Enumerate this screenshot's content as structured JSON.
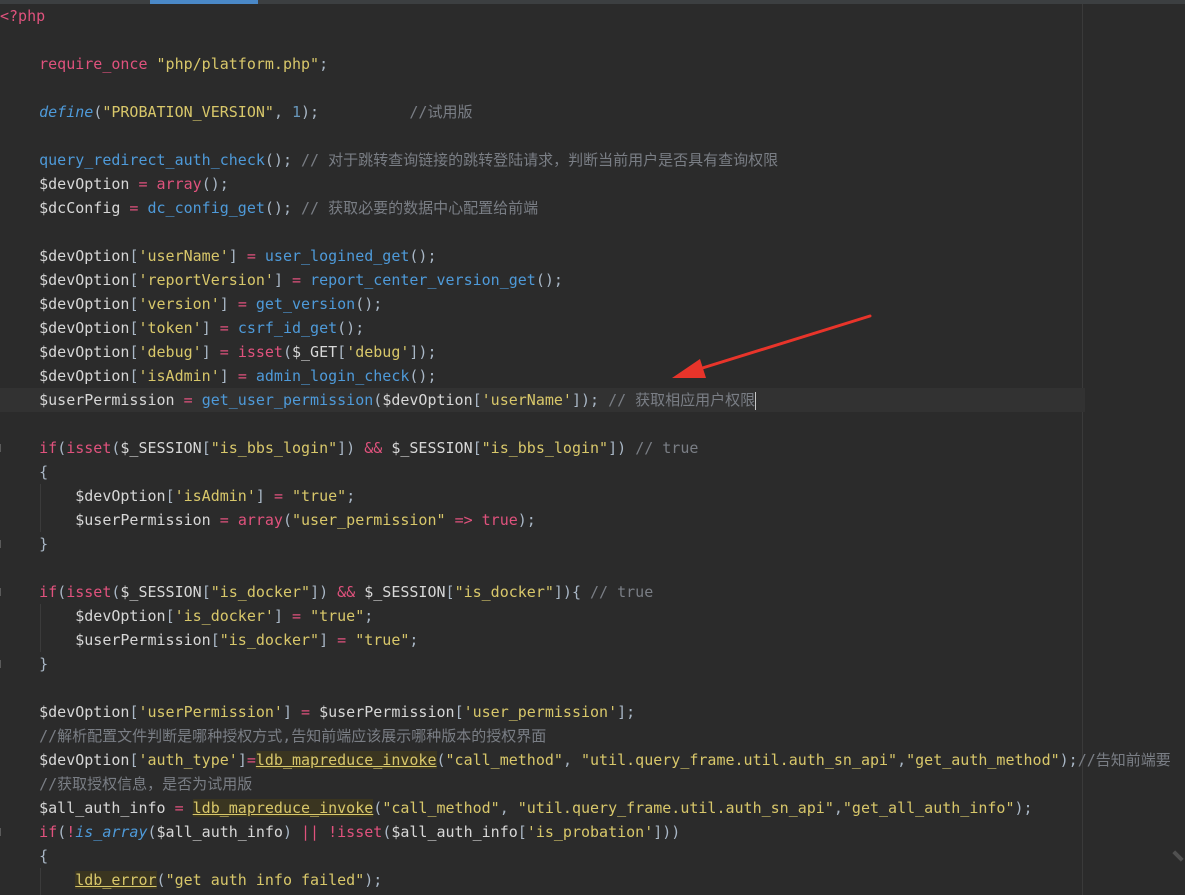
{
  "editor": {
    "lines": [
      {
        "id": "l1",
        "tokens": [
          {
            "t": "<?php",
            "c": "phptag"
          }
        ]
      },
      {
        "id": "l2",
        "tokens": []
      },
      {
        "id": "l3",
        "tokens": [
          {
            "t": "    "
          },
          {
            "t": "require_once",
            "c": "pink"
          },
          {
            "t": " "
          },
          {
            "t": "\"php/platform.php\"",
            "c": "str"
          },
          {
            "t": ";",
            "c": "punc"
          }
        ]
      },
      {
        "id": "l4",
        "tokens": []
      },
      {
        "id": "l5",
        "tokens": [
          {
            "t": "    "
          },
          {
            "t": "define",
            "c": "def"
          },
          {
            "t": "(",
            "c": "punc"
          },
          {
            "t": "\"PROBATION_VERSION\"",
            "c": "str"
          },
          {
            "t": ", ",
            "c": "punc"
          },
          {
            "t": "1",
            "c": "num"
          },
          {
            "t": ");",
            "c": "punc"
          },
          {
            "t": "          "
          },
          {
            "t": "//试用版",
            "c": "cmt"
          }
        ]
      },
      {
        "id": "l6",
        "tokens": []
      },
      {
        "id": "l7",
        "tokens": [
          {
            "t": "    "
          },
          {
            "t": "query_redirect_auth_check",
            "c": "fn"
          },
          {
            "t": "(); ",
            "c": "punc"
          },
          {
            "t": "// 对于跳转查询链接的跳转登陆请求，判断当前用户是否具有查询权限",
            "c": "cmt"
          }
        ]
      },
      {
        "id": "l8",
        "tokens": [
          {
            "t": "    "
          },
          {
            "t": "$devOption",
            "c": "var"
          },
          {
            "t": " = ",
            "c": "pink"
          },
          {
            "t": "array",
            "c": "pink"
          },
          {
            "t": "();",
            "c": "punc"
          }
        ]
      },
      {
        "id": "l9",
        "tokens": [
          {
            "t": "    "
          },
          {
            "t": "$dcConfig",
            "c": "var"
          },
          {
            "t": " = ",
            "c": "pink"
          },
          {
            "t": "dc_config_get",
            "c": "fn"
          },
          {
            "t": "(); ",
            "c": "punc"
          },
          {
            "t": "// 获取必要的数据中心配置给前端",
            "c": "cmt"
          }
        ]
      },
      {
        "id": "l10",
        "tokens": []
      },
      {
        "id": "l11",
        "tokens": [
          {
            "t": "    "
          },
          {
            "t": "$devOption",
            "c": "var"
          },
          {
            "t": "[",
            "c": "punc"
          },
          {
            "t": "'userName'",
            "c": "str"
          },
          {
            "t": "] ",
            "c": "punc"
          },
          {
            "t": "=",
            "c": "pink"
          },
          {
            "t": " "
          },
          {
            "t": "user_logined_get",
            "c": "fn"
          },
          {
            "t": "();",
            "c": "punc"
          }
        ]
      },
      {
        "id": "l12",
        "tokens": [
          {
            "t": "    "
          },
          {
            "t": "$devOption",
            "c": "var"
          },
          {
            "t": "[",
            "c": "punc"
          },
          {
            "t": "'reportVersion'",
            "c": "str"
          },
          {
            "t": "] ",
            "c": "punc"
          },
          {
            "t": "=",
            "c": "pink"
          },
          {
            "t": " "
          },
          {
            "t": "report_center_version_get",
            "c": "fn"
          },
          {
            "t": "();",
            "c": "punc"
          }
        ]
      },
      {
        "id": "l13",
        "tokens": [
          {
            "t": "    "
          },
          {
            "t": "$devOption",
            "c": "var"
          },
          {
            "t": "[",
            "c": "punc"
          },
          {
            "t": "'version'",
            "c": "str"
          },
          {
            "t": "] ",
            "c": "punc"
          },
          {
            "t": "=",
            "c": "pink"
          },
          {
            "t": " "
          },
          {
            "t": "get_version",
            "c": "fn"
          },
          {
            "t": "();",
            "c": "punc"
          }
        ]
      },
      {
        "id": "l14",
        "tokens": [
          {
            "t": "    "
          },
          {
            "t": "$devOption",
            "c": "var"
          },
          {
            "t": "[",
            "c": "punc"
          },
          {
            "t": "'token'",
            "c": "str"
          },
          {
            "t": "] ",
            "c": "punc"
          },
          {
            "t": "=",
            "c": "pink"
          },
          {
            "t": " "
          },
          {
            "t": "csrf_id_get",
            "c": "fn"
          },
          {
            "t": "();",
            "c": "punc"
          }
        ]
      },
      {
        "id": "l15",
        "tokens": [
          {
            "t": "    "
          },
          {
            "t": "$devOption",
            "c": "var"
          },
          {
            "t": "[",
            "c": "punc"
          },
          {
            "t": "'debug'",
            "c": "str"
          },
          {
            "t": "] ",
            "c": "punc"
          },
          {
            "t": "=",
            "c": "pink"
          },
          {
            "t": " "
          },
          {
            "t": "isset",
            "c": "pink"
          },
          {
            "t": "(",
            "c": "punc"
          },
          {
            "t": "$_GET",
            "c": "var"
          },
          {
            "t": "[",
            "c": "punc"
          },
          {
            "t": "'debug'",
            "c": "str"
          },
          {
            "t": "]);",
            "c": "punc"
          }
        ]
      },
      {
        "id": "l16",
        "tokens": [
          {
            "t": "    "
          },
          {
            "t": "$devOption",
            "c": "var"
          },
          {
            "t": "[",
            "c": "punc"
          },
          {
            "t": "'isAdmin'",
            "c": "str"
          },
          {
            "t": "] ",
            "c": "punc"
          },
          {
            "t": "=",
            "c": "pink"
          },
          {
            "t": " "
          },
          {
            "t": "admin_login_check",
            "c": "fn"
          },
          {
            "t": "();",
            "c": "punc"
          }
        ]
      },
      {
        "id": "l17",
        "current": true,
        "tokens": [
          {
            "t": "    "
          },
          {
            "t": "$userPermission",
            "c": "var"
          },
          {
            "t": " = ",
            "c": "pink"
          },
          {
            "t": "get_user_permission",
            "c": "fn"
          },
          {
            "t": "(",
            "c": "punc"
          },
          {
            "t": "$devOption",
            "c": "var"
          },
          {
            "t": "[",
            "c": "punc"
          },
          {
            "t": "'userName'",
            "c": "str"
          },
          {
            "t": "]); ",
            "c": "punc"
          },
          {
            "t": "// 获取相应用户权限",
            "c": "cmt"
          }
        ]
      },
      {
        "id": "l18",
        "tokens": []
      },
      {
        "id": "l19",
        "tokens": [
          {
            "t": "    "
          },
          {
            "t": "if",
            "c": "pink"
          },
          {
            "t": "(",
            "c": "punc"
          },
          {
            "t": "isset",
            "c": "pink"
          },
          {
            "t": "(",
            "c": "punc"
          },
          {
            "t": "$_SESSION",
            "c": "var"
          },
          {
            "t": "[",
            "c": "punc"
          },
          {
            "t": "\"is_bbs_login\"",
            "c": "str"
          },
          {
            "t": "]) ",
            "c": "punc"
          },
          {
            "t": "&&",
            "c": "pink"
          },
          {
            "t": " "
          },
          {
            "t": "$_SESSION",
            "c": "var"
          },
          {
            "t": "[",
            "c": "punc"
          },
          {
            "t": "\"is_bbs_login\"",
            "c": "str"
          },
          {
            "t": "]) ",
            "c": "punc"
          },
          {
            "t": "// true",
            "c": "cmt"
          }
        ]
      },
      {
        "id": "l20",
        "tokens": [
          {
            "t": "    "
          },
          {
            "t": "{",
            "c": "punc"
          }
        ]
      },
      {
        "id": "l21",
        "tokens": [
          {
            "t": "        "
          },
          {
            "t": "$devOption",
            "c": "var"
          },
          {
            "t": "[",
            "c": "punc"
          },
          {
            "t": "'isAdmin'",
            "c": "str"
          },
          {
            "t": "] ",
            "c": "punc"
          },
          {
            "t": "=",
            "c": "pink"
          },
          {
            "t": " "
          },
          {
            "t": "\"true\"",
            "c": "str"
          },
          {
            "t": ";",
            "c": "punc"
          }
        ]
      },
      {
        "id": "l22",
        "tokens": [
          {
            "t": "        "
          },
          {
            "t": "$userPermission",
            "c": "var"
          },
          {
            "t": " = ",
            "c": "pink"
          },
          {
            "t": "array",
            "c": "pink"
          },
          {
            "t": "(",
            "c": "punc"
          },
          {
            "t": "\"user_permission\"",
            "c": "str"
          },
          {
            "t": " "
          },
          {
            "t": "=>",
            "c": "pink"
          },
          {
            "t": " "
          },
          {
            "t": "true",
            "c": "pink"
          },
          {
            "t": ");",
            "c": "punc"
          }
        ]
      },
      {
        "id": "l23",
        "tokens": [
          {
            "t": "    "
          },
          {
            "t": "}",
            "c": "punc"
          }
        ]
      },
      {
        "id": "l24",
        "tokens": []
      },
      {
        "id": "l25",
        "tokens": [
          {
            "t": "    "
          },
          {
            "t": "if",
            "c": "pink"
          },
          {
            "t": "(",
            "c": "punc"
          },
          {
            "t": "isset",
            "c": "pink"
          },
          {
            "t": "(",
            "c": "punc"
          },
          {
            "t": "$_SESSION",
            "c": "var"
          },
          {
            "t": "[",
            "c": "punc"
          },
          {
            "t": "\"is_docker\"",
            "c": "str"
          },
          {
            "t": "]) ",
            "c": "punc"
          },
          {
            "t": "&&",
            "c": "pink"
          },
          {
            "t": " "
          },
          {
            "t": "$_SESSION",
            "c": "var"
          },
          {
            "t": "[",
            "c": "punc"
          },
          {
            "t": "\"is_docker\"",
            "c": "str"
          },
          {
            "t": "]){ ",
            "c": "punc"
          },
          {
            "t": "// true",
            "c": "cmt"
          }
        ]
      },
      {
        "id": "l26",
        "tokens": [
          {
            "t": "        "
          },
          {
            "t": "$devOption",
            "c": "var"
          },
          {
            "t": "[",
            "c": "punc"
          },
          {
            "t": "'is_docker'",
            "c": "str"
          },
          {
            "t": "] ",
            "c": "punc"
          },
          {
            "t": "=",
            "c": "pink"
          },
          {
            "t": " "
          },
          {
            "t": "\"true\"",
            "c": "str"
          },
          {
            "t": ";",
            "c": "punc"
          }
        ]
      },
      {
        "id": "l27",
        "tokens": [
          {
            "t": "        "
          },
          {
            "t": "$userPermission",
            "c": "var"
          },
          {
            "t": "[",
            "c": "punc"
          },
          {
            "t": "\"is_docker\"",
            "c": "str"
          },
          {
            "t": "] ",
            "c": "punc"
          },
          {
            "t": "=",
            "c": "pink"
          },
          {
            "t": " "
          },
          {
            "t": "\"true\"",
            "c": "str"
          },
          {
            "t": ";",
            "c": "punc"
          }
        ]
      },
      {
        "id": "l28",
        "tokens": [
          {
            "t": "    "
          },
          {
            "t": "}",
            "c": "punc"
          }
        ]
      },
      {
        "id": "l29",
        "tokens": []
      },
      {
        "id": "l30",
        "tokens": [
          {
            "t": "    "
          },
          {
            "t": "$devOption",
            "c": "var"
          },
          {
            "t": "[",
            "c": "punc"
          },
          {
            "t": "'userPermission'",
            "c": "str"
          },
          {
            "t": "] ",
            "c": "punc"
          },
          {
            "t": "=",
            "c": "pink"
          },
          {
            "t": " "
          },
          {
            "t": "$userPermission",
            "c": "var"
          },
          {
            "t": "[",
            "c": "punc"
          },
          {
            "t": "'user_permission'",
            "c": "str"
          },
          {
            "t": "];",
            "c": "punc"
          }
        ]
      },
      {
        "id": "l31",
        "tokens": [
          {
            "t": "    "
          },
          {
            "t": "//解析配置文件判断是哪种授权方式,告知前端应该展示哪种版本的授权界面",
            "c": "cmt"
          }
        ]
      },
      {
        "id": "l32",
        "tokens": [
          {
            "t": "    "
          },
          {
            "t": "$devOption",
            "c": "var"
          },
          {
            "t": "[",
            "c": "punc"
          },
          {
            "t": "'auth_type'",
            "c": "str"
          },
          {
            "t": "]",
            "c": "punc"
          },
          {
            "t": "=",
            "c": "pink"
          },
          {
            "t": "ldb_mapreduce_invoke",
            "c": "underline-fn"
          },
          {
            "t": "(",
            "c": "punc"
          },
          {
            "t": "\"call_method\"",
            "c": "str"
          },
          {
            "t": ", ",
            "c": "punc"
          },
          {
            "t": "\"util.query_frame.util.auth_sn_api\"",
            "c": "str"
          },
          {
            "t": ",",
            "c": "punc"
          },
          {
            "t": "\"get_auth_method\"",
            "c": "str"
          },
          {
            "t": ");",
            "c": "punc"
          },
          {
            "t": "//告知前端要按照",
            "c": "cmt"
          }
        ]
      },
      {
        "id": "l33",
        "tokens": [
          {
            "t": "    "
          },
          {
            "t": "//获取授权信息，是否为试用版",
            "c": "cmt"
          }
        ]
      },
      {
        "id": "l34",
        "tokens": [
          {
            "t": "    "
          },
          {
            "t": "$all_auth_info",
            "c": "var"
          },
          {
            "t": " = ",
            "c": "pink"
          },
          {
            "t": "ldb_mapreduce_invoke",
            "c": "underline-fn"
          },
          {
            "t": "(",
            "c": "punc"
          },
          {
            "t": "\"call_method\"",
            "c": "str"
          },
          {
            "t": ", ",
            "c": "punc"
          },
          {
            "t": "\"util.query_frame.util.auth_sn_api\"",
            "c": "str"
          },
          {
            "t": ",",
            "c": "punc"
          },
          {
            "t": "\"get_all_auth_info\"",
            "c": "str"
          },
          {
            "t": ");",
            "c": "punc"
          }
        ]
      },
      {
        "id": "l35",
        "tokens": [
          {
            "t": "    "
          },
          {
            "t": "if",
            "c": "pink"
          },
          {
            "t": "(",
            "c": "punc"
          },
          {
            "t": "!",
            "c": "pink"
          },
          {
            "t": "is_array",
            "c": "def"
          },
          {
            "t": "(",
            "c": "punc"
          },
          {
            "t": "$all_auth_info",
            "c": "var"
          },
          {
            "t": ") ",
            "c": "punc"
          },
          {
            "t": "||",
            "c": "pink"
          },
          {
            "t": " "
          },
          {
            "t": "!",
            "c": "pink"
          },
          {
            "t": "isset",
            "c": "pink"
          },
          {
            "t": "(",
            "c": "punc"
          },
          {
            "t": "$all_auth_info",
            "c": "var"
          },
          {
            "t": "[",
            "c": "punc"
          },
          {
            "t": "'is_probation'",
            "c": "str"
          },
          {
            "t": "]))",
            "c": "punc"
          }
        ]
      },
      {
        "id": "l36",
        "tokens": [
          {
            "t": "    "
          },
          {
            "t": "{",
            "c": "punc"
          }
        ]
      },
      {
        "id": "l37",
        "tokens": [
          {
            "t": "        "
          },
          {
            "t": "ldb_error",
            "c": "underline-fn"
          },
          {
            "t": "(",
            "c": "punc"
          },
          {
            "t": "\"get auth info failed\"",
            "c": "str"
          },
          {
            "t": ");",
            "c": "punc"
          }
        ]
      }
    ]
  },
  "colors": {
    "background": "#2b2b2b",
    "current_line": "#323232",
    "annotation_arrow": "#e8342a",
    "active_tab": "#4a88c7"
  }
}
